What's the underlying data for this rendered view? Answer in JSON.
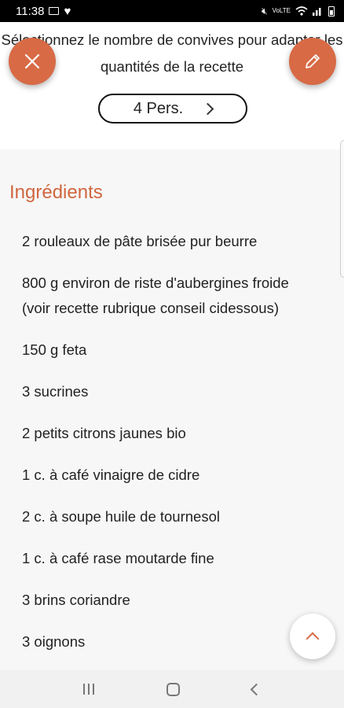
{
  "status_bar": {
    "time": "11:38",
    "left_icons": [
      "image-icon",
      "heart-icon"
    ],
    "right_icons": [
      "mute-icon",
      "volte-icon",
      "wifi-icon",
      "signal-icon",
      "battery-icon"
    ]
  },
  "servings": {
    "instruction": "Sélectionnez le nombre de convives pour adapter les quantités de la recette",
    "value": "4 Pers."
  },
  "ingredients": {
    "title": "Ingrédients",
    "items": [
      "2 rouleaux de pâte brisée pur beurre",
      "800 g environ de riste d'aubergines froide (voir recette rubrique conseil cidessous)",
      "150 g feta",
      "3 sucrines",
      "2 petits citrons jaunes bio",
      "1 c. à café vinaigre de cidre",
      "2 c. à soupe huile de tournesol",
      "1 c. à café rase moutarde fine",
      "3 brins coriandre",
      "3 oignons"
    ]
  },
  "colors": {
    "accent": "#d86a45",
    "title": "#d0663f"
  },
  "icons": {
    "close": "close-icon",
    "edit": "pencil-icon",
    "next": "chevron-right-icon",
    "scroll_top": "chevron-up-icon",
    "nav": [
      "recent-apps-icon",
      "home-icon",
      "back-icon"
    ]
  }
}
